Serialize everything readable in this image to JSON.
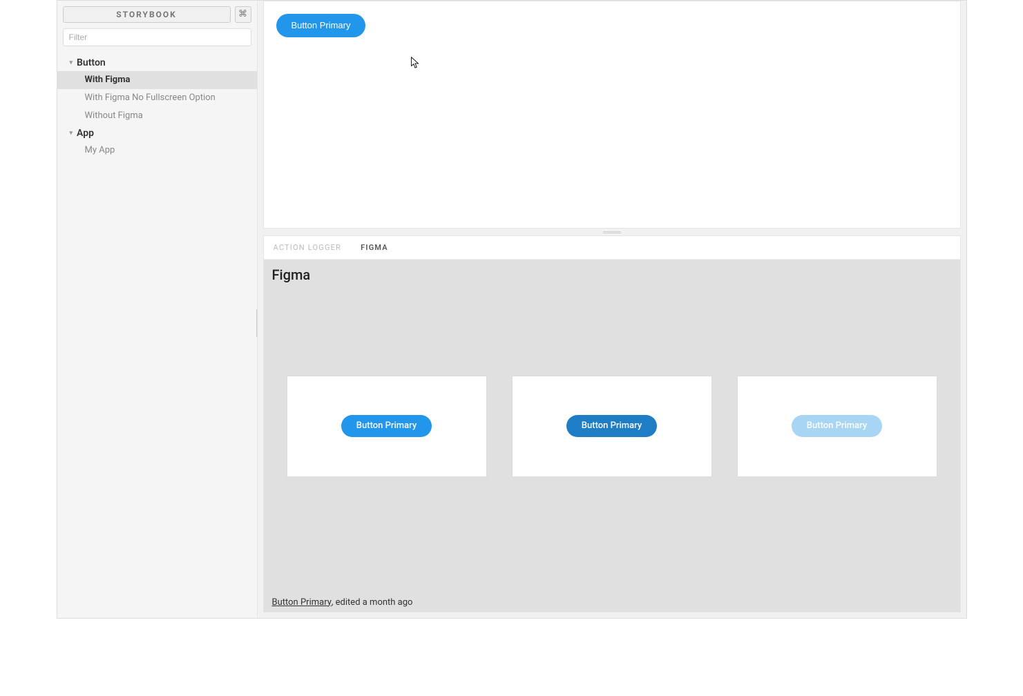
{
  "sidebar": {
    "brand": "STORYBOOK",
    "shortcut_symbol": "⌘",
    "filter_placeholder": "Filter",
    "groups": [
      {
        "label": "Button",
        "expanded": true,
        "items": [
          {
            "label": "With Figma",
            "selected": true
          },
          {
            "label": "With Figma No Fullscreen Option",
            "selected": false
          },
          {
            "label": "Without Figma",
            "selected": false
          }
        ]
      },
      {
        "label": "App",
        "expanded": true,
        "items": [
          {
            "label": "My App",
            "selected": false
          }
        ]
      }
    ]
  },
  "preview": {
    "button_label": "Button Primary",
    "button_bg": "#2196eb"
  },
  "addon_tabs": [
    {
      "label": "ACTION LOGGER",
      "active": false
    },
    {
      "label": "FIGMA",
      "active": true
    }
  ],
  "figma_panel": {
    "title": "Figma",
    "variants": [
      {
        "label": "Button Primary",
        "bg": "#2196eb"
      },
      {
        "label": "Button Primary",
        "bg": "#1e7dc4"
      },
      {
        "label": "Button Primary",
        "bg": "#a8d5f3"
      }
    ],
    "footer_link": "Button Primary",
    "footer_suffix": ", edited a month ago"
  }
}
